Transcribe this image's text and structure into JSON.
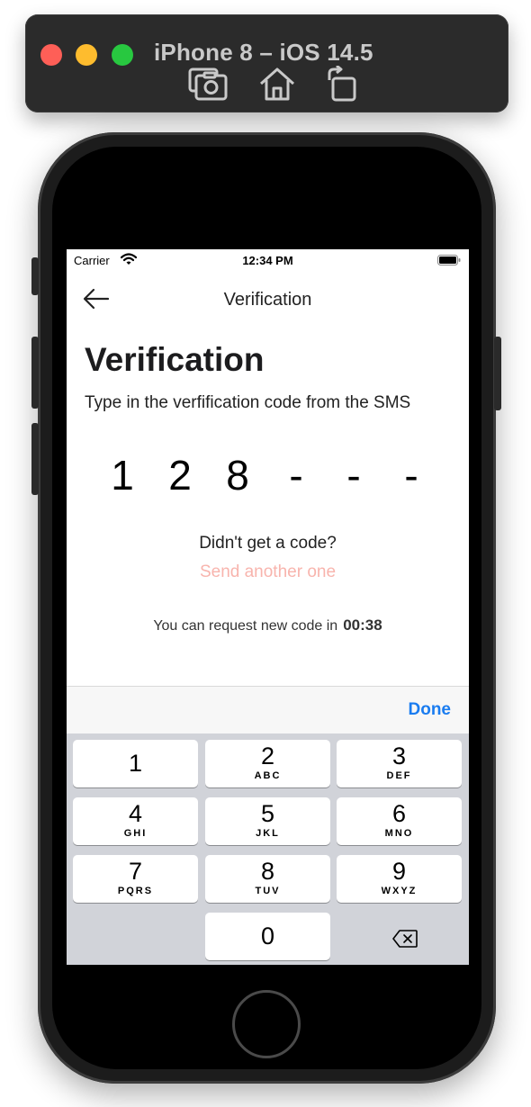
{
  "simulator": {
    "title": "iPhone 8 – iOS 14.5",
    "controls": [
      "screenshot-icon",
      "home-icon",
      "rotate-icon"
    ]
  },
  "status_bar": {
    "carrier": "Carrier",
    "time": "12:34 PM"
  },
  "nav": {
    "title": "Verification",
    "back_icon": "arrow-left-icon"
  },
  "main": {
    "title": "Verification",
    "subtitle": "Type in the verfification code from the SMS",
    "code": [
      "1",
      "2",
      "8",
      "-",
      "-",
      "-"
    ],
    "resend_question": "Didn't get a code?",
    "resend_link": "Send another one",
    "timer_prefix": "You can request new code in",
    "timer_value": "00:38"
  },
  "keyboard": {
    "done_label": "Done",
    "keys": [
      {
        "num": "1",
        "letters": ""
      },
      {
        "num": "2",
        "letters": "ABC"
      },
      {
        "num": "3",
        "letters": "DEF"
      },
      {
        "num": "4",
        "letters": "GHI"
      },
      {
        "num": "5",
        "letters": "JKL"
      },
      {
        "num": "6",
        "letters": "MNO"
      },
      {
        "num": "7",
        "letters": "PQRS"
      },
      {
        "num": "8",
        "letters": "TUV"
      },
      {
        "num": "9",
        "letters": "WXYZ"
      },
      {
        "num": "0",
        "letters": ""
      }
    ],
    "backspace_icon": "backspace-icon"
  },
  "colors": {
    "link_disabled": "#f8b4ad",
    "done_blue": "#1a7cf0",
    "keypad_bg": "#d1d3d9"
  }
}
